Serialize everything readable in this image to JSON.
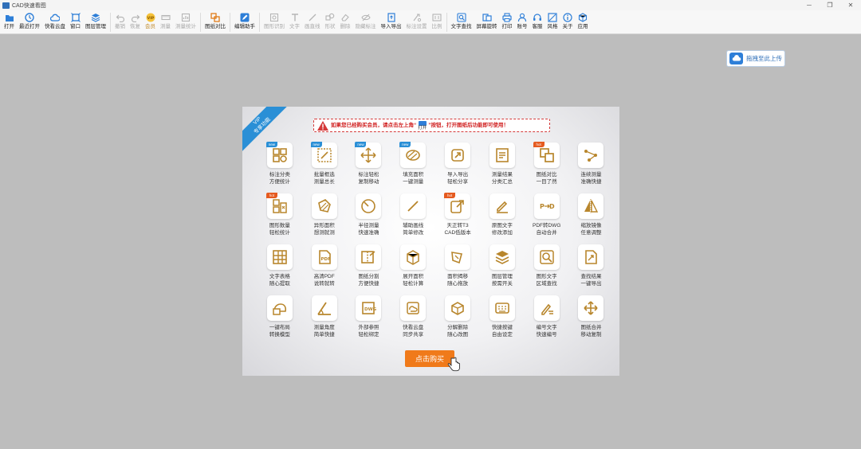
{
  "window": {
    "title": "CAD快速看图"
  },
  "toolbar": {
    "groups": [
      [
        {
          "label": "打开",
          "icon": "folder-icon",
          "state": "enabled"
        },
        {
          "label": "最近打开",
          "icon": "clock-icon",
          "state": "enabled"
        },
        {
          "label": "快看云盘",
          "icon": "cloud-icon",
          "state": "enabled"
        },
        {
          "label": "窗口",
          "icon": "window-icon",
          "state": "enabled"
        },
        {
          "label": "图层管理",
          "icon": "layers-icon",
          "state": "enabled"
        }
      ],
      [
        {
          "label": "撤销",
          "icon": "undo-icon",
          "state": "disabled"
        },
        {
          "label": "恢复",
          "icon": "redo-icon",
          "state": "disabled"
        },
        {
          "label": "会员",
          "icon": "vip-icon",
          "state": "vip"
        },
        {
          "label": "测量",
          "icon": "ruler-icon",
          "state": "disabled"
        },
        {
          "label": "测量统计",
          "icon": "stats-icon",
          "state": "disabled"
        }
      ],
      [
        {
          "label": "图纸对比",
          "icon": "compare-icon",
          "state": "enabled"
        }
      ],
      [
        {
          "label": "编辑助手",
          "icon": "edit-assistant-icon",
          "state": "enabled"
        }
      ],
      [
        {
          "label": "图形识别",
          "icon": "shape-recog-icon",
          "state": "disabled"
        },
        {
          "label": "文字",
          "icon": "text-icon",
          "state": "disabled"
        },
        {
          "label": "画直线",
          "icon": "line-icon",
          "state": "disabled"
        },
        {
          "label": "形状",
          "icon": "shape-icon",
          "state": "disabled"
        },
        {
          "label": "删除",
          "icon": "eraser-icon",
          "state": "disabled"
        },
        {
          "label": "隐藏标注",
          "icon": "hide-icon",
          "state": "disabled"
        },
        {
          "label": "导入导出",
          "icon": "import-export-icon",
          "state": "enabled"
        },
        {
          "label": "标注设置",
          "icon": "annotate-settings-icon",
          "state": "disabled"
        },
        {
          "label": "比例",
          "icon": "scale-icon",
          "state": "disabled"
        }
      ],
      [
        {
          "label": "文字查找",
          "icon": "text-search-icon",
          "state": "enabled"
        },
        {
          "label": "屏幕旋转",
          "icon": "rotate-icon",
          "state": "enabled"
        },
        {
          "label": "打印",
          "icon": "print-icon",
          "state": "enabled"
        },
        {
          "label": "账号",
          "icon": "user-icon",
          "state": "enabled"
        },
        {
          "label": "客服",
          "icon": "headset-icon",
          "state": "enabled"
        },
        {
          "label": "风格",
          "icon": "style-icon",
          "state": "enabled"
        },
        {
          "label": "关于",
          "icon": "info-icon",
          "state": "enabled"
        },
        {
          "label": "应用",
          "icon": "cube-icon",
          "state": "enabled"
        }
      ]
    ]
  },
  "upload": {
    "label": "拖拽至此上传"
  },
  "panel": {
    "ribbon": "VIP\n专享功能",
    "notice": {
      "prefix": "如果您已经购买会员，请点击左上角“",
      "open_label": "打开",
      "suffix": "”按钮，打开图纸后功能即可使用！"
    },
    "features": [
      {
        "label": "标注分类\n方便统计",
        "icon": "annotate-classify-icon",
        "badge": "new"
      },
      {
        "label": "批量框选\n测量总长",
        "icon": "batch-select-icon",
        "badge": "new"
      },
      {
        "label": "标注轻松\n复制移动",
        "icon": "move-arrows-icon",
        "badge": "new"
      },
      {
        "label": "填充面积\n一键测量",
        "icon": "fill-area-icon",
        "badge": "new"
      },
      {
        "label": "导入导出\n轻松分享",
        "icon": "share-export-icon",
        "badge": ""
      },
      {
        "label": "测量结果\n分类汇总",
        "icon": "summary-icon",
        "badge": ""
      },
      {
        "label": "图纸对比\n一目了然",
        "icon": "compare-icon",
        "badge": "hot"
      },
      {
        "label": "连续测量\n准确快捷",
        "icon": "continuous-measure-icon",
        "badge": ""
      },
      {
        "label": "图形数量\n轻松统计",
        "icon": "shape-count-icon",
        "badge": "hot"
      },
      {
        "label": "异形面积\n想测就测",
        "icon": "irregular-area-icon",
        "badge": ""
      },
      {
        "label": "半径测量\n快速准确",
        "icon": "radius-icon",
        "badge": ""
      },
      {
        "label": "辅助画线\n简单修改",
        "icon": "line-icon",
        "badge": ""
      },
      {
        "label": "天正转T3\nCAD低版本",
        "icon": "convert-icon",
        "badge": "hot"
      },
      {
        "label": "原图文字\n修改添加",
        "icon": "pen-icon",
        "badge": ""
      },
      {
        "label": "PDF转DWG\n自动合并",
        "icon": "pdf-dwg-icon",
        "badge": ""
      },
      {
        "label": "缩放镜像\n任意调整",
        "icon": "mirror-icon",
        "badge": ""
      },
      {
        "label": "文字表格\n随心提取",
        "icon": "table-icon",
        "badge": ""
      },
      {
        "label": "高清PDF\n说转就转",
        "icon": "pdf-icon",
        "badge": ""
      },
      {
        "label": "图纸分割\n方便快捷",
        "icon": "split-icon",
        "badge": ""
      },
      {
        "label": "展开面积\n轻松计算",
        "icon": "unfold-area-icon",
        "badge": ""
      },
      {
        "label": "面积揭移\n随心拖放",
        "icon": "area-move-icon",
        "badge": ""
      },
      {
        "label": "图层管理\n按需开关",
        "icon": "layers-icon",
        "badge": ""
      },
      {
        "label": "图形文字\n区域查找",
        "icon": "area-search-icon",
        "badge": ""
      },
      {
        "label": "查找结果\n一键导出",
        "icon": "search-export-icon",
        "badge": ""
      },
      {
        "label": "一键布局\n转换模型",
        "icon": "layout-convert-icon",
        "badge": ""
      },
      {
        "label": "测量角度\n简单快捷",
        "icon": "angle-icon",
        "badge": ""
      },
      {
        "label": "外部参照\n轻松绑定",
        "icon": "xref-icon",
        "badge": ""
      },
      {
        "label": "快看云盘\n同步共享",
        "icon": "cloud-sync-icon",
        "badge": ""
      },
      {
        "label": "分解删除\n随心改图",
        "icon": "explode-icon",
        "badge": ""
      },
      {
        "label": "快捷按键\n自由设定",
        "icon": "keyboard-icon",
        "badge": ""
      },
      {
        "label": "编号文字\n快速编号",
        "icon": "numbering-icon",
        "badge": ""
      },
      {
        "label": "图纸合并\n移动复制",
        "icon": "merge-move-icon",
        "badge": ""
      }
    ],
    "buy_button": "点击购买"
  },
  "colors": {
    "accent": "#2a8fd6",
    "gold": "#c08b2b",
    "buy": "#f07a1a",
    "warning": "#d01f1f"
  }
}
